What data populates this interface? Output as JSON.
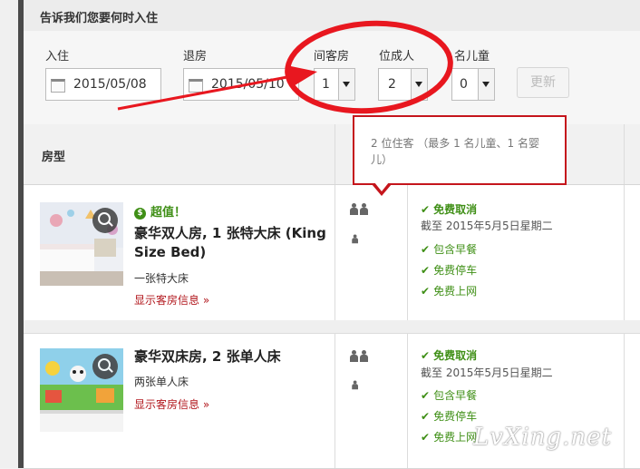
{
  "header": {
    "title": "告诉我们您要何时入住"
  },
  "search": {
    "checkin_label": "入住",
    "checkin_value": "2015/05/08",
    "checkout_label": "退房",
    "checkout_value": "2015/05/10",
    "rooms_label": "间客房",
    "rooms_value": "1",
    "adults_label": "位成人",
    "adults_value": "2",
    "children_label": "名儿童",
    "children_value": "0",
    "update_label": "更新"
  },
  "table": {
    "room_type_header": "房型"
  },
  "tooltip": {
    "text": "2 位住客 （最多 1 名儿童、1 名婴儿）"
  },
  "rooms": [
    {
      "deal": "超值！",
      "deal_icon": "$",
      "name": "豪华双人房, 1 张特大床 (King Size Bed)",
      "bed": "一张特大床",
      "more": "显示客房信息 »",
      "cancel": "免费取消",
      "until": "截至 2015年5月5日星期二",
      "perks": [
        "包含早餐",
        "免费停车",
        "免费上网"
      ]
    },
    {
      "name": "豪华双床房, 2 张单人床",
      "bed": "两张单人床",
      "more": "显示客房信息 »",
      "cancel": "免费取消",
      "until": "截至 2015年5月5日星期二",
      "perks": [
        "包含早餐",
        "免费停车",
        "免费上网"
      ]
    }
  ],
  "check_mark": "✔",
  "watermark": "LvXing.net",
  "colors": {
    "highlight_red": "#e8171f",
    "deal_green": "#3f8f16",
    "link_red": "#b2181e"
  }
}
